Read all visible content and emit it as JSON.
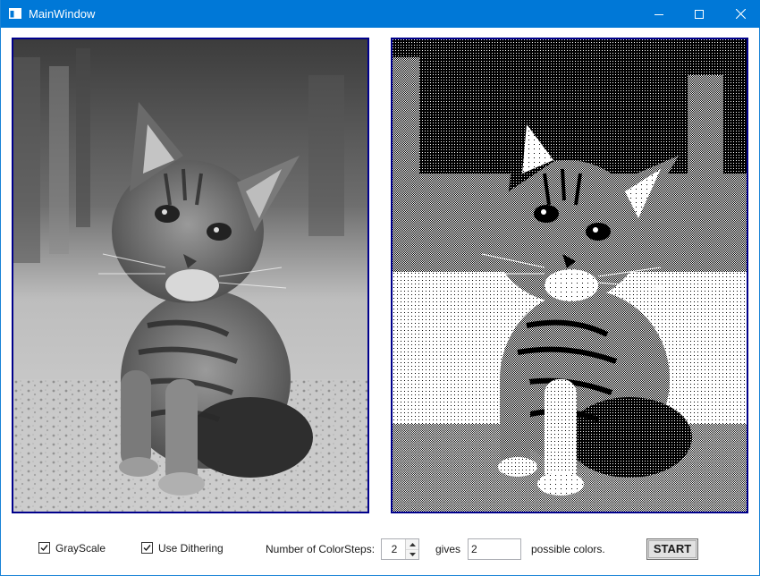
{
  "window": {
    "title": "MainWindow",
    "icons": {
      "app": "app-window-icon",
      "minimize": "minimize-icon",
      "maximize": "maximize-icon",
      "close": "close-icon"
    },
    "colors": {
      "titlebar": "#0078d7",
      "panel_border": "#00008b"
    }
  },
  "images": {
    "original": "grayscale kitten photo",
    "processed": "black-and-white dithered kitten image"
  },
  "controls": {
    "grayscale_label": "GrayScale",
    "grayscale_checked": true,
    "dithering_label": "Use Dithering",
    "dithering_checked": true,
    "colorsteps_label": "Number of ColorSteps:",
    "colorsteps_value": "2",
    "gives_label": "gives",
    "gives_value": "2",
    "possible_label": "possible colors.",
    "start_label": "START"
  }
}
